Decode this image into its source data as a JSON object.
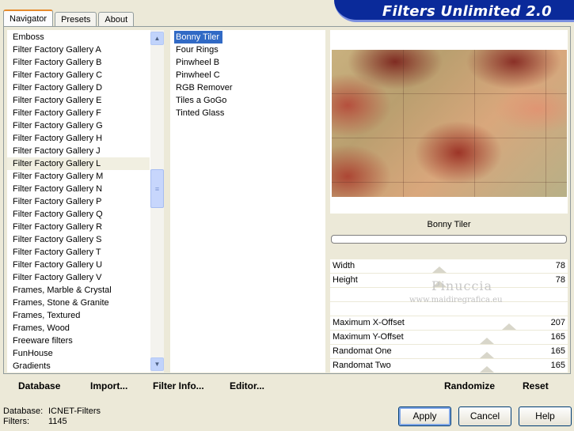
{
  "tabs": [
    "Navigator",
    "Presets",
    "About"
  ],
  "banner_title": "Filters Unlimited 2.0",
  "categories": [
    "Emboss",
    "Filter Factory Gallery A",
    "Filter Factory Gallery B",
    "Filter Factory Gallery C",
    "Filter Factory Gallery D",
    "Filter Factory Gallery E",
    "Filter Factory Gallery F",
    "Filter Factory Gallery G",
    "Filter Factory Gallery H",
    "Filter Factory Gallery J",
    "Filter Factory Gallery L",
    "Filter Factory Gallery M",
    "Filter Factory Gallery N",
    "Filter Factory Gallery P",
    "Filter Factory Gallery Q",
    "Filter Factory Gallery R",
    "Filter Factory Gallery S",
    "Filter Factory Gallery T",
    "Filter Factory Gallery U",
    "Filter Factory Gallery V",
    "Frames, Marble & Crystal",
    "Frames, Stone & Granite",
    "Frames, Textured",
    "Frames, Wood",
    "Freeware filters",
    "FunHouse",
    "Gradients"
  ],
  "selected_category": "Filter Factory Gallery L",
  "filters": [
    "Bonny Tiler",
    "Four Rings",
    "Pinwheel B",
    "Pinwheel C",
    "RGB Remover",
    "Tiles a GoGo",
    "Tinted Glass"
  ],
  "selected_filter": "Bonny Tiler",
  "preview_filter_name": "Bonny Tiler",
  "params": [
    {
      "label": "Width",
      "value": "78",
      "level": 0.31
    },
    {
      "label": "Height",
      "value": "78",
      "level": 0.31
    },
    {
      "label": "",
      "value": "",
      "level": null
    },
    {
      "label": "",
      "value": "",
      "level": null
    },
    {
      "label": "Maximum X-Offset",
      "value": "207",
      "level": 0.81
    },
    {
      "label": "Maximum Y-Offset",
      "value": "165",
      "level": 0.65
    },
    {
      "label": "Randomat One",
      "value": "165",
      "level": 0.65
    },
    {
      "label": "Randomat Two",
      "value": "165",
      "level": 0.65
    }
  ],
  "watermark": {
    "name": "Pinuccia",
    "site": "www.maidiregrafica.eu"
  },
  "left_buttons": {
    "database": "Database",
    "import": "Import...",
    "filter_info": "Filter Info...",
    "editor": "Editor..."
  },
  "right_buttons": {
    "randomize": "Randomize",
    "reset": "Reset"
  },
  "status": {
    "db_label": "Database:",
    "db_value": "ICNET-Filters",
    "filters_label": "Filters:",
    "filters_value": "1145"
  },
  "dialog_buttons": {
    "apply": "Apply",
    "cancel": "Cancel",
    "help": "Help"
  },
  "icons": {
    "scroll_up": "chevron-up-icon",
    "scroll_down": "chevron-down-icon",
    "scroll_grip": "grip-icon"
  }
}
